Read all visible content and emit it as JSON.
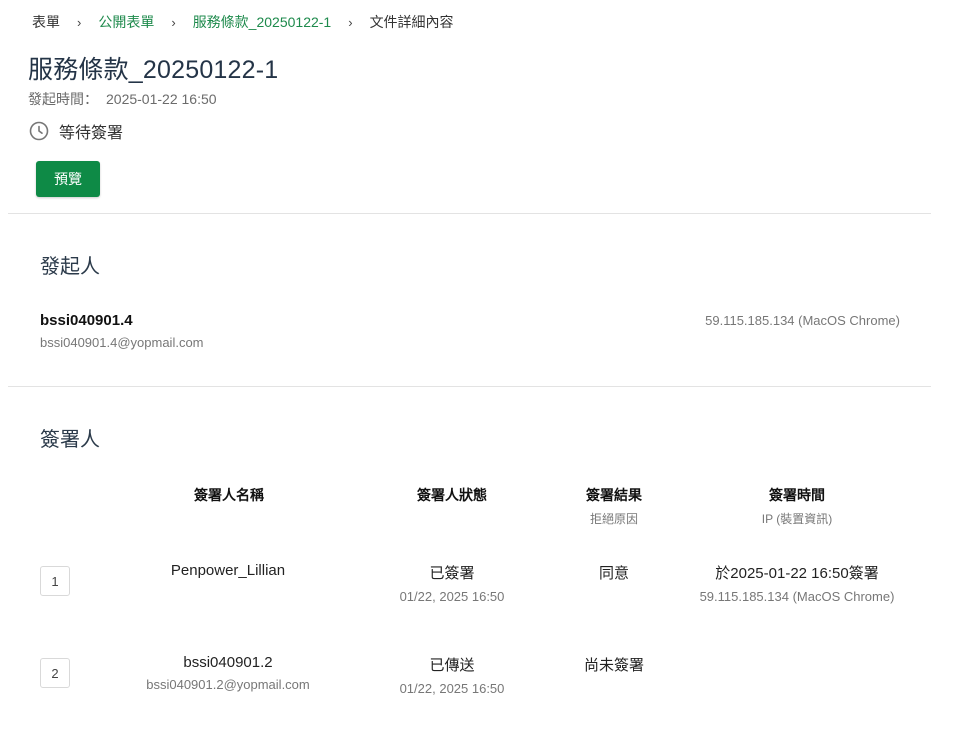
{
  "breadcrumb": {
    "items": [
      "表單",
      "公開表單",
      "服務條款_20250122-1",
      "文件詳細內容"
    ],
    "separator": "›"
  },
  "document": {
    "title": "服務條款_20250122-1",
    "start_time_label": "發起時間：",
    "start_time_value": "2025-01-22 16:50",
    "status_icon": "clock-icon",
    "status": "等待簽署",
    "preview_label": "預覽"
  },
  "initiator": {
    "section_title": "發起人",
    "name": "bssi040901.4",
    "email": "bssi040901.4@yopmail.com",
    "ip": "59.115.185.134 (MacOS Chrome)"
  },
  "signers": {
    "section_title": "簽署人",
    "headers": {
      "name": "簽署人名稱",
      "status": "簽署人狀態",
      "result": "簽署結果",
      "result_sub": "拒絕原因",
      "time": "簽署時間",
      "time_sub": "IP (裝置資訊)"
    },
    "rows": [
      {
        "index": "1",
        "name": "Penpower_Lillian",
        "email": "",
        "status": "已簽署",
        "status_time": "01/22, 2025 16:50",
        "result": "同意",
        "signed_time": "於2025-01-22 16:50簽署",
        "ip": "59.115.185.134 (MacOS Chrome)"
      },
      {
        "index": "2",
        "name": "bssi040901.2",
        "email": "bssi040901.2@yopmail.com",
        "status": "已傳送",
        "status_time": "01/22, 2025 16:50",
        "result": "尚未簽署",
        "signed_time": "",
        "ip": ""
      }
    ]
  },
  "colors": {
    "accent": "#0e8a46",
    "link": "#1e8a4c",
    "title": "#243447"
  }
}
